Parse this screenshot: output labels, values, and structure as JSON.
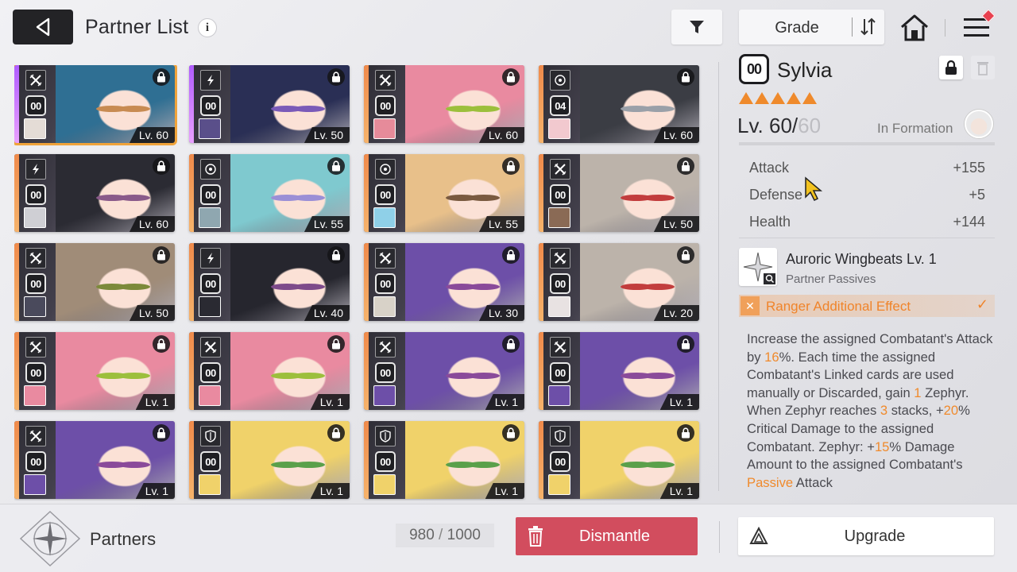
{
  "header": {
    "title": "Partner List",
    "info_glyph": "i",
    "sort_label": "Grade"
  },
  "grid": {
    "cards": [
      {
        "class_icon": "ranger-icon",
        "grade": "00",
        "level": "Lv. 60",
        "selected": true,
        "rarity": "sr",
        "hair": "#2f6f93",
        "eye": "#c88b52",
        "avatar": "#e4dcd6"
      },
      {
        "class_icon": "lightning-icon",
        "grade": "00",
        "level": "Lv. 50",
        "selected": false,
        "rarity": "sr",
        "hair": "#2a2f55",
        "eye": "#7a5ab8",
        "avatar": "#5a4f8a"
      },
      {
        "class_icon": "ranger-icon",
        "grade": "00",
        "level": "Lv. 60",
        "selected": false,
        "rarity": "r",
        "hair": "#e98aa0",
        "eye": "#9cbf3c",
        "avatar": "#e68b9a"
      },
      {
        "class_icon": "target-icon",
        "grade": "04",
        "level": "Lv. 60",
        "selected": false,
        "rarity": "r",
        "hair": "#3b3d44",
        "eye": "#9aa0a8",
        "avatar": "#f2c9cf"
      },
      {
        "class_icon": "lightning-icon",
        "grade": "00",
        "level": "Lv. 60",
        "selected": false,
        "rarity": "r",
        "hair": "#2b2b33",
        "eye": "#8a5a8a",
        "avatar": "#cfcfd4"
      },
      {
        "class_icon": "target-icon",
        "grade": "00",
        "level": "Lv. 55",
        "selected": false,
        "rarity": "r",
        "hair": "#7fc9cf",
        "eye": "#9b8fd6",
        "avatar": "#8fa7b0"
      },
      {
        "class_icon": "target-icon",
        "grade": "00",
        "level": "Lv. 55",
        "selected": false,
        "rarity": "r",
        "hair": "#e8c08a",
        "eye": "#7a5a40",
        "avatar": "#8fd0e8"
      },
      {
        "class_icon": "ranger-icon",
        "grade": "00",
        "level": "Lv. 50",
        "selected": false,
        "rarity": "r",
        "hair": "#bcb3aa",
        "eye": "#c23d3d",
        "avatar": "#8a6a55"
      },
      {
        "class_icon": "ranger-icon",
        "grade": "00",
        "level": "Lv. 50",
        "selected": false,
        "rarity": "r",
        "hair": "#a08c78",
        "eye": "#7c8a3a",
        "avatar": "#4a4a5c"
      },
      {
        "class_icon": "lightning-icon",
        "grade": "00",
        "level": "Lv. 40",
        "selected": false,
        "rarity": "r",
        "hair": "#26262e",
        "eye": "#7d4a8a",
        "avatar": "#2a2a32"
      },
      {
        "class_icon": "ranger-icon",
        "grade": "00",
        "level": "Lv. 30",
        "selected": false,
        "rarity": "r",
        "hair": "#6d4fa8",
        "eye": "#8a4a9a",
        "avatar": "#d8d2c8"
      },
      {
        "class_icon": "ranger-icon",
        "grade": "00",
        "level": "Lv. 20",
        "selected": false,
        "rarity": "r",
        "hair": "#bcb3aa",
        "eye": "#c23d3d",
        "avatar": "#e8e2e2"
      },
      {
        "class_icon": "ranger-icon",
        "grade": "00",
        "level": "Lv. 1",
        "selected": false,
        "rarity": "r",
        "hair": "#e98aa0",
        "eye": "#9cbf3c",
        "avatar": "#e98aa0"
      },
      {
        "class_icon": "ranger-icon",
        "grade": "00",
        "level": "Lv. 1",
        "selected": false,
        "rarity": "r",
        "hair": "#e98aa0",
        "eye": "#9cbf3c",
        "avatar": "#e98aa0"
      },
      {
        "class_icon": "ranger-icon",
        "grade": "00",
        "level": "Lv. 1",
        "selected": false,
        "rarity": "r",
        "hair": "#6d4fa8",
        "eye": "#8a4a9a",
        "avatar": "#6d4fa8"
      },
      {
        "class_icon": "ranger-icon",
        "grade": "00",
        "level": "Lv. 1",
        "selected": false,
        "rarity": "r",
        "hair": "#6d4fa8",
        "eye": "#8a4a9a",
        "avatar": "#6d4fa8"
      },
      {
        "class_icon": "ranger-icon",
        "grade": "00",
        "level": "Lv. 1",
        "selected": false,
        "rarity": "r",
        "hair": "#6d4fa8",
        "eye": "#8a4a9a",
        "avatar": "#6d4fa8"
      },
      {
        "class_icon": "shield-icon",
        "grade": "00",
        "level": "Lv. 1",
        "selected": false,
        "rarity": "r",
        "hair": "#f0d26a",
        "eye": "#5aa04a",
        "avatar": "#f0d26a"
      },
      {
        "class_icon": "shield-icon",
        "grade": "00",
        "level": "Lv. 1",
        "selected": false,
        "rarity": "r",
        "hair": "#f0d26a",
        "eye": "#5aa04a",
        "avatar": "#f0d26a"
      },
      {
        "class_icon": "shield-icon",
        "grade": "00",
        "level": "Lv. 1",
        "selected": false,
        "rarity": "r",
        "hair": "#f0d26a",
        "eye": "#5aa04a",
        "avatar": "#f0d26a"
      }
    ]
  },
  "detail": {
    "grade": "00",
    "name": "Sylvia",
    "stars": 5,
    "level_current": "Lv. 60/",
    "level_max": "60",
    "formation_label": "In Formation",
    "stats": [
      {
        "label": "Attack",
        "value": "+155"
      },
      {
        "label": "Defense",
        "value": "+5"
      },
      {
        "label": "Health",
        "value": "+144"
      }
    ],
    "skill_name": "Auroric Wingbeats Lv. 1",
    "skill_type": "Partner Passives",
    "ranger_label": "Ranger Additional Effect",
    "desc": [
      {
        "t": "Increase the assigned Combatant's Attack by "
      },
      {
        "t": "16",
        "hl": true
      },
      {
        "t": "%. Each time the assigned Combatant's Linked cards are used manually or Discarded, gain "
      },
      {
        "t": "1",
        "hl": true
      },
      {
        "t": " Zephyr. When Zephyr reaches "
      },
      {
        "t": "3",
        "hl": true
      },
      {
        "t": " stacks, +"
      },
      {
        "t": "20",
        "hl": true
      },
      {
        "t": "% Critical Damage to the assigned Combatant. Zephyr: +"
      },
      {
        "t": "15",
        "hl": true
      },
      {
        "t": "% Damage Amount to the assigned Combatant's "
      },
      {
        "t": "Passive",
        "hl": true
      },
      {
        "t": " Attack"
      }
    ]
  },
  "footer": {
    "section_label": "Partners",
    "capacity_current": "980",
    "capacity_sep": " / ",
    "capacity_max": "1000",
    "dismantle_label": "Dismantle",
    "upgrade_label": "Upgrade"
  },
  "colors": {
    "accent_orange": "#f08a2c",
    "dismantle_red": "#d24d5e",
    "selected_outline": "#f0a33a"
  }
}
